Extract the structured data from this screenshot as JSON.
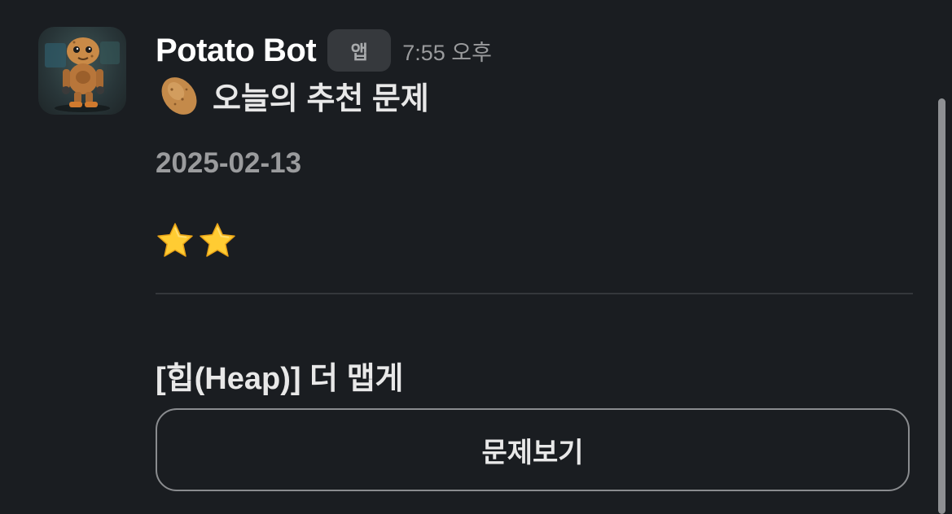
{
  "message": {
    "bot_name": "Potato Bot",
    "app_badge": "앱",
    "timestamp": "7:55 오후",
    "title": "오늘의 추천 문제",
    "title_icon": "potato-icon",
    "date": "2025-02-13",
    "difficulty_stars": 2,
    "star_icon": "star-icon",
    "problem_title": "[힙(Heap)] 더 맵게",
    "button_label": "문제보기"
  },
  "colors": {
    "background": "#1a1d21",
    "bot_name": "#ffffff",
    "secondary_text": "#9a9b9d",
    "badge_background": "#36393d",
    "divider": "#34373b",
    "button_border": "#8a8c8f",
    "star": "#ffcc33"
  }
}
